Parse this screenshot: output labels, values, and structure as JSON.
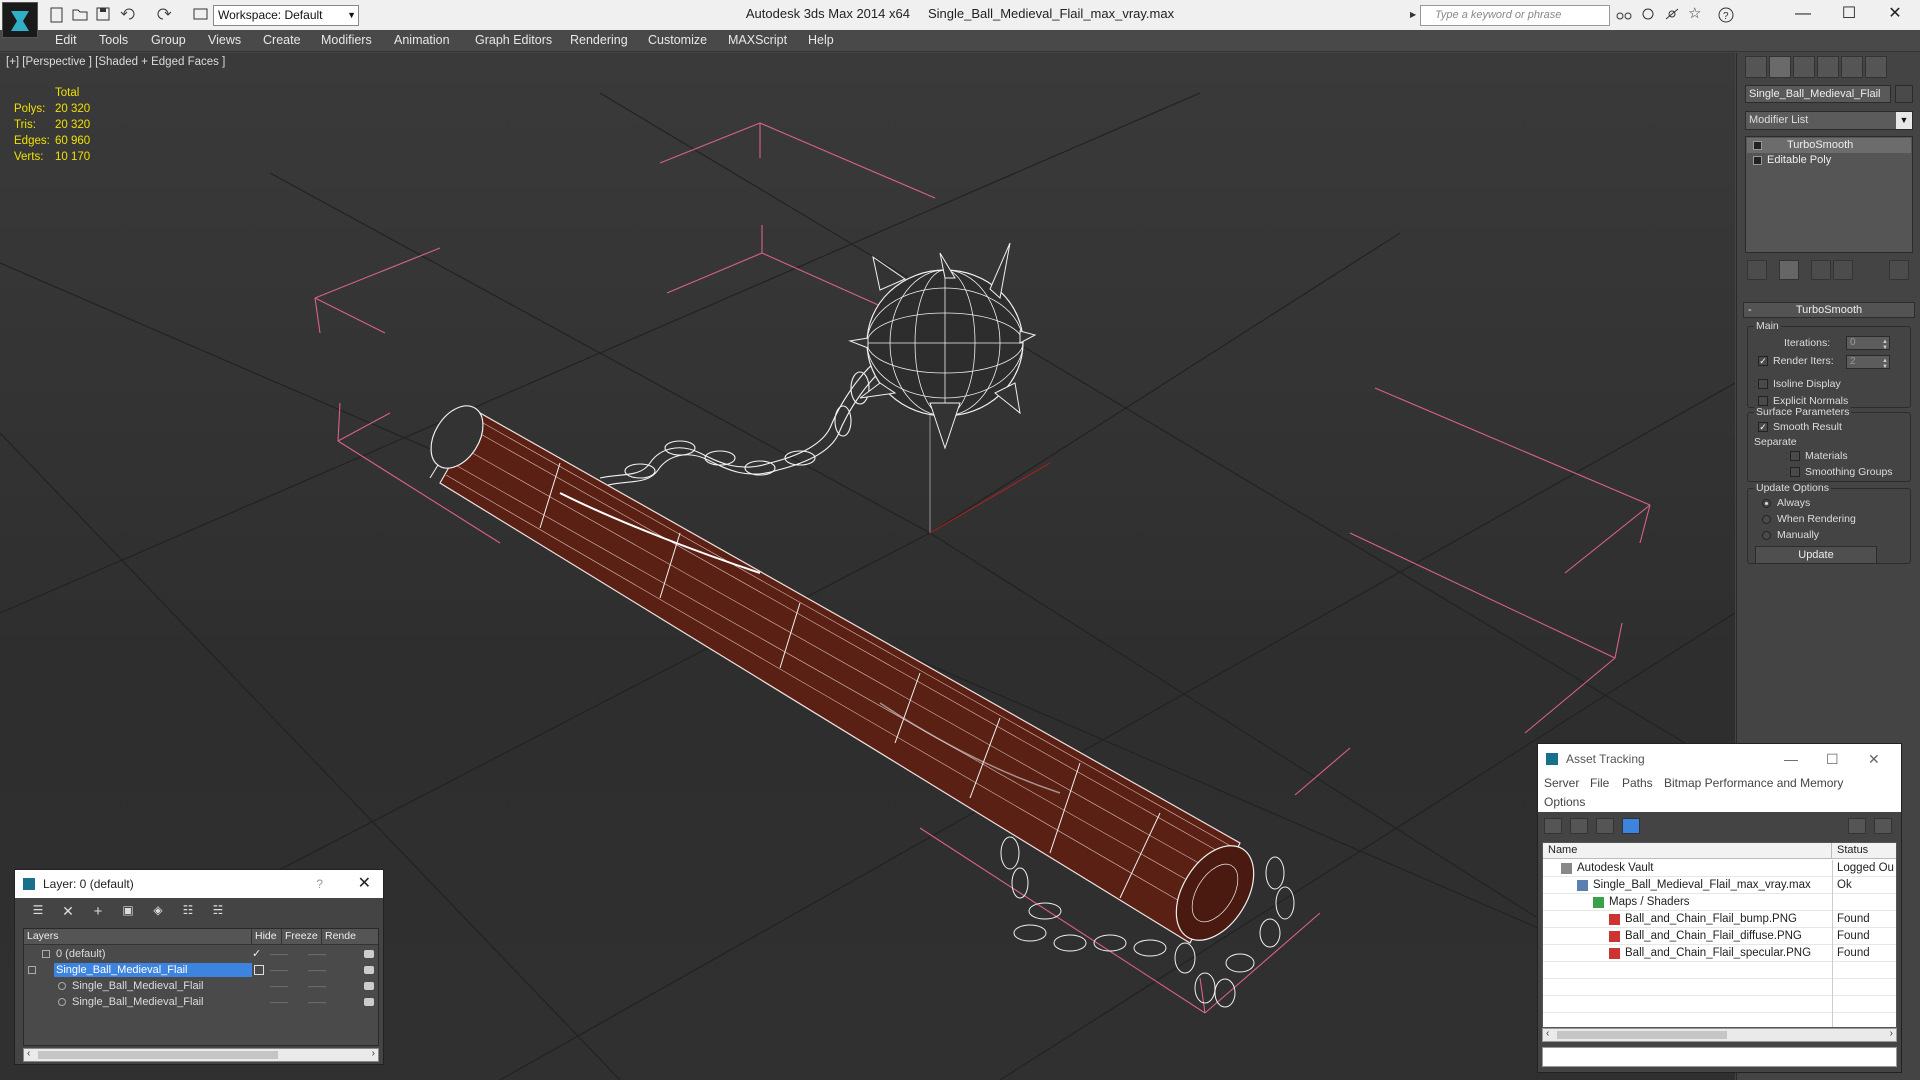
{
  "titlebar": {
    "app_name": "Autodesk 3ds Max  2014 x64",
    "file_name": "Single_Ball_Medieval_Flail_max_vray.max",
    "workspace": "Workspace: Default",
    "search_placeholder": "Type a keyword or phrase",
    "minimize": "—",
    "maximize": "☐",
    "close": "✕"
  },
  "menubar": {
    "items": [
      "Edit",
      "Tools",
      "Group",
      "Views",
      "Create",
      "Modifiers",
      "Animation",
      "Graph Editors",
      "Rendering",
      "Customize",
      "MAXScript",
      "Help"
    ]
  },
  "viewport": {
    "label": "[+] [Perspective ] [Shaded + Edged Faces ]",
    "stats": {
      "header": "Total",
      "rows": [
        {
          "k": "Polys:",
          "v": "20 320"
        },
        {
          "k": "Tris:",
          "v": "20 320"
        },
        {
          "k": "Edges:",
          "v": "60 960"
        },
        {
          "k": "Verts:",
          "v": "10 170"
        }
      ]
    }
  },
  "command_panel": {
    "object_name": "Single_Ball_Medieval_Flail",
    "modifier_list": "Modifier List",
    "stack": [
      "TurboSmooth",
      "Editable Poly"
    ],
    "rollout": {
      "title": "TurboSmooth",
      "main": {
        "title": "Main",
        "iterations_label": "Iterations:",
        "iterations_value": "0",
        "render_iters_label": "Render Iters:",
        "render_iters_value": "2",
        "render_iters_checked": "✓",
        "isoline": "Isoline Display",
        "explicit": "Explicit Normals"
      },
      "surface": {
        "title": "Surface Parameters",
        "smooth": "Smooth Result",
        "smooth_checked": "✓",
        "separate": "Separate",
        "materials": "Materials",
        "smoothing_groups": "Smoothing Groups"
      },
      "update": {
        "title": "Update Options",
        "always": "Always",
        "when_rendering": "When Rendering",
        "manually": "Manually",
        "button": "Update"
      }
    }
  },
  "layer_window": {
    "title": "Layer: 0 (default)",
    "help": "?",
    "close": "✕",
    "columns": [
      "Layers",
      "Hide",
      "Freeze",
      "Rende"
    ],
    "rows": [
      {
        "name": "0 (default)",
        "check": "✓"
      },
      {
        "name": "Single_Ball_Medieval_Flail",
        "check": ""
      },
      {
        "name": "Single_Ball_Medieval_Flail",
        "check": ""
      },
      {
        "name": "Single_Ball_Medieval_Flail",
        "check": ""
      }
    ],
    "dash": "——"
  },
  "asset_window": {
    "title": "Asset Tracking",
    "menu": [
      "Server",
      "File",
      "Paths",
      "Bitmap Performance and Memory",
      "Options"
    ],
    "columns": [
      "Name",
      "Status"
    ],
    "rows": [
      {
        "name": "Autodesk Vault",
        "status": "Logged Ou"
      },
      {
        "name": "Single_Ball_Medieval_Flail_max_vray.max",
        "status": "Ok"
      },
      {
        "name": "Maps / Shaders",
        "status": ""
      },
      {
        "name": "Ball_and_Chain_Flail_bump.PNG",
        "status": "Found"
      },
      {
        "name": "Ball_and_Chain_Flail_diffuse.PNG",
        "status": "Found"
      },
      {
        "name": "Ball_and_Chain_Flail_specular.PNG",
        "status": "Found"
      }
    ]
  }
}
